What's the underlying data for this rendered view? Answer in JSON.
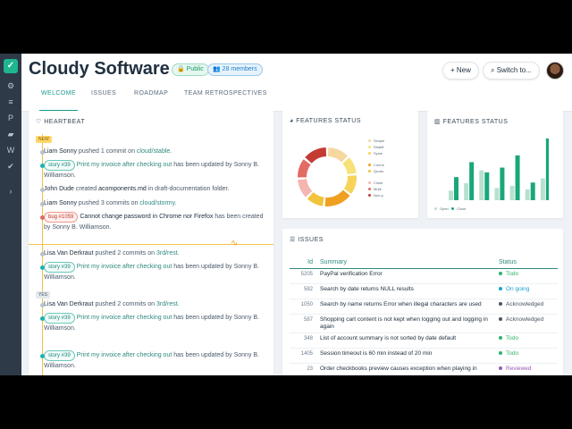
{
  "header": {
    "title": "Cloudy Software",
    "public_badge": "Public",
    "members_badge": "28 members",
    "new_button": "New",
    "switch_button": "Switch to..."
  },
  "tabs": [
    "WELCOME",
    "ISSUES",
    "ROADMAP",
    "TEAM RETROSPECTIVES"
  ],
  "heartbeat": {
    "title": "HEARTBEAT",
    "day_new": "NEW",
    "day_yes": "YES",
    "items": [
      {
        "user": "Liam Sonny",
        "text": "pushed 1 commit on",
        "link": "cloud/stable."
      },
      {
        "pill": "story #39",
        "link": "Print my invoice after checking out",
        "text": "has been updated by",
        "user": "Sonny B. Williamson."
      },
      {
        "user": "John Dude",
        "text": "created",
        "file": "acomponents.md",
        "text2": "in draft-documentation folder."
      },
      {
        "user": "Liam Sonny",
        "text": "pushed 3 commits on",
        "link": "cloud/stormy."
      },
      {
        "pill": "bug #1059",
        "plain": "Cannot change password in Chrome nor Firefox",
        "text": "has been created by",
        "user": "Sonny B. Williamson."
      },
      {
        "user": "Lisa Van Derkraut",
        "text": "pushed 2 commits on",
        "link": "3rd/rest."
      },
      {
        "pill": "story #39",
        "link": "Print my invoice after checking out",
        "text": "has been updated by",
        "user": "Sonny B. Williamson."
      },
      {
        "user": "Lisa Van Derkraut",
        "text": "pushed 2 commits on",
        "link": "3rd/rest."
      },
      {
        "pill": "story #39",
        "link": "Print my invoice after checking out",
        "text": "has been updated by",
        "user": "Sonny B. Williamson."
      },
      {
        "pill": "story #39",
        "link": "Print my invoice after checking out",
        "text": "has been updated by",
        "user": "Sonny B. Williamson."
      }
    ]
  },
  "features_donut": {
    "title": "FEATURES STATUS",
    "legend": [
      {
        "label": "Simple",
        "color": "#f5d8a0"
      },
      {
        "label": "Stratifi",
        "color": "#f7e27a"
      },
      {
        "label": "Syste",
        "color": "#f7d35a"
      },
      {
        "label": "Conne",
        "color": "#f0a020"
      },
      {
        "label": "Quota",
        "color": "#f2c43c"
      },
      {
        "label": "Clustr",
        "color": "#f5b5b0"
      },
      {
        "label": "Multi-",
        "color": "#e26b63"
      },
      {
        "label": "Non-p",
        "color": "#c33b33"
      }
    ]
  },
  "features_bar": {
    "title": "FEATURES STATUS",
    "legend_open": "Open",
    "legend_close": "Close",
    "open_color": "#b8e0cf",
    "close_color": "#1aa77a"
  },
  "chart_data": {
    "type": "bar",
    "categories": [
      "1",
      "2",
      "3",
      "4",
      "5",
      "6",
      "7"
    ],
    "series": [
      {
        "name": "Open",
        "values": [
          14,
          25,
          44,
          18,
          21,
          16,
          32
        ]
      },
      {
        "name": "Close",
        "values": [
          34,
          56,
          41,
          48,
          66,
          26,
          91
        ]
      }
    ],
    "ylim": [
      0,
      100
    ]
  },
  "issues": {
    "title": "ISSUES",
    "columns": [
      "Id",
      "Summary",
      "Status"
    ],
    "rows": [
      {
        "id": "5205",
        "summary": "PayPal verification Error",
        "status": "Todo",
        "color": "#2fb36b"
      },
      {
        "id": "582",
        "summary": "Search by date returns NULL results",
        "status": "On going",
        "color": "#1aa3c8"
      },
      {
        "id": "1050",
        "summary": "Search by name returns Error when illegal characters are used",
        "status": "Acknowledged",
        "color": "#4a5560"
      },
      {
        "id": "587",
        "summary": "Shopping cart content is not kept when logging out and logging in again",
        "status": "Acknowledged",
        "color": "#4a5560"
      },
      {
        "id": "348",
        "summary": "List of account summary is not sorted by date default",
        "status": "Todo",
        "color": "#2fb36b"
      },
      {
        "id": "1405",
        "summary": "Session timeout is 60 min instead of 20 min",
        "status": "Todo",
        "color": "#2fb36b"
      },
      {
        "id": "23",
        "summary": "Order checkbooks preview causes exception when playing in",
        "status": "Reviewed",
        "color": "#9b59b6"
      }
    ]
  }
}
